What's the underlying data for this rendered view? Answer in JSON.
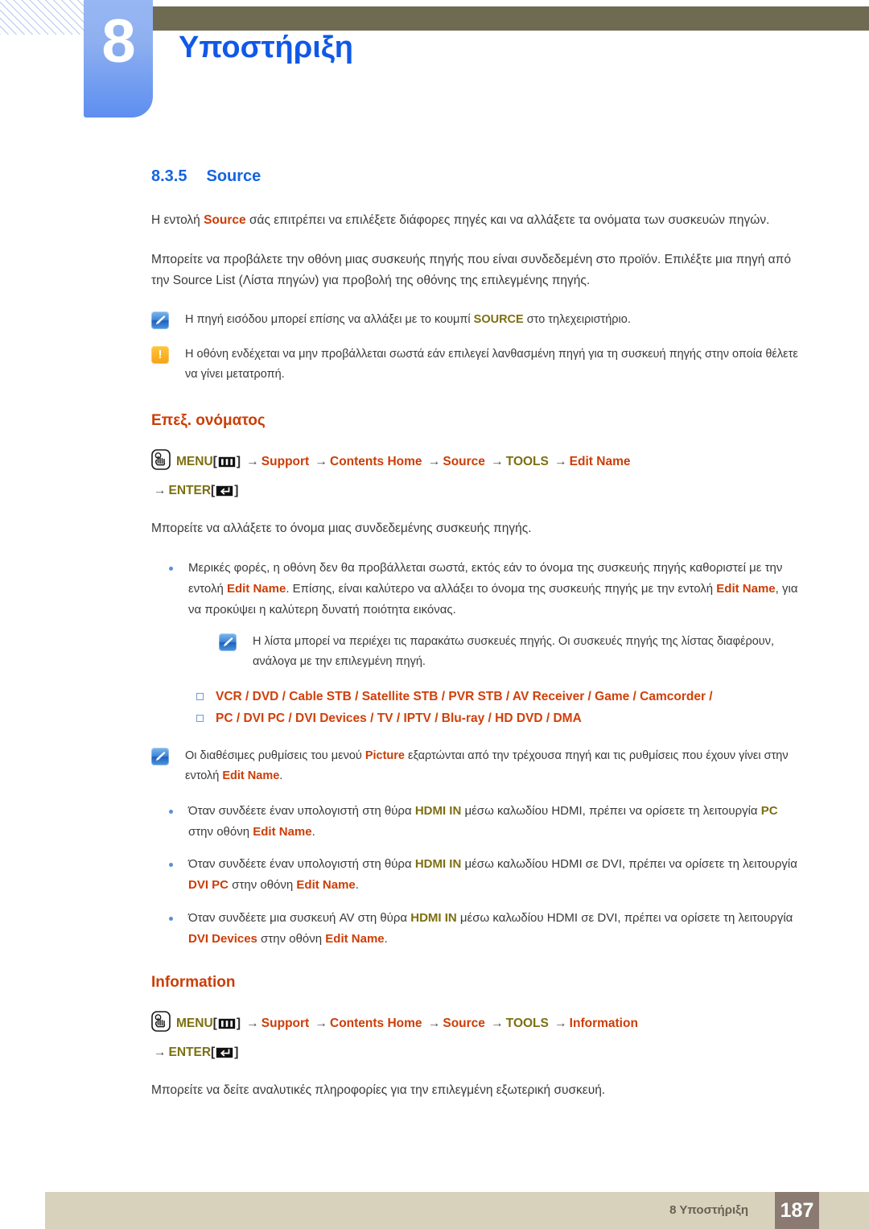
{
  "header": {
    "chapter_number": "8",
    "chapter_title": "Υποστήριξη",
    "accent_blue": "#1058e8",
    "olive_bar_color": "#6f6a52",
    "tab_color": "#6f9bf0"
  },
  "section": {
    "number": "8.3.5",
    "title": "Source",
    "heading_color": "#1565e0"
  },
  "intro": {
    "p1_before": "Η εντολή ",
    "p1_highlight": "Source",
    "p1_after": " σάς επιτρέπει να επιλέξετε διάφορες πηγές και να αλλάξετε τα ονόματα των συσκευών πηγών.",
    "p2": "Μπορείτε να προβάλετε την οθόνη μιας συσκευής πηγής που είναι συνδεδεμένη στο προϊόν. Επιλέξτε μια πηγή από την Source List (Λίστα πηγών) για προβολή της οθόνης της επιλεγμένης πηγής."
  },
  "notes": {
    "note1_before": "Η πηγή εισόδου μπορεί επίσης να αλλάξει με το κουμπί ",
    "note1_key": "SOURCE",
    "note1_after": " στο τηλεχειριστήριο.",
    "warn1": "Η οθόνη ενδέχεται να μην προβάλλεται σωστά εάν επιλεγεί λανθασμένη πηγή για τη συσκευή πηγής στην οποία θέλετε να γίνει μετατροπή.",
    "note2": "Η λίστα μπορεί να περιέχει τις παρακάτω συσκευές πηγής. Οι συσκευές πηγής της λίστας διαφέρουν, ανάλογα με την επιλεγμένη πηγή.",
    "note3_a": "Οι διαθέσιμες ρυθμίσεις του μενού ",
    "note3_picture": "Picture",
    "note3_b": " εξαρτώνται από την τρέχουσα πηγή και τις ρυθμίσεις που έχουν γίνει στην εντολή ",
    "note3_editname": "Edit Name",
    "note3_c": "."
  },
  "edit_name": {
    "sub_heading": "Επεξ. ονόματος",
    "menu_path": {
      "hand_icon": "hand-pointer-icon",
      "menu_label": "MENU",
      "menu_key_icon": "menu-bars-icon",
      "steps": [
        "Support",
        "Contents Home",
        "Source",
        "TOOLS",
        "Edit Name"
      ],
      "enter_label": "ENTER",
      "enter_key_icon": "enter-arrow-icon",
      "arrow": "→",
      "bracket_open": "[",
      "bracket_close": "]"
    },
    "body": "Μπορείτε να αλλάξετε το όνομα μιας συνδεδεμένης συσκευής πηγής.",
    "bullet1_a": "Μερικές φορές, η οθόνη δεν θα προβάλλεται σωστά, εκτός εάν το όνομα της συσκευής πηγής καθοριστεί με την εντολή ",
    "bullet1_edit1": "Edit Name",
    "bullet1_b": ". Επίσης, είναι καλύτερο να αλλάξει το όνομα της συσκευής πηγής με την εντολή ",
    "bullet1_edit2": "Edit Name",
    "bullet1_c": ", για να προκύψει η καλύτερη δυνατή ποιότητα εικόνας.",
    "devices_line1": "VCR / DVD / Cable STB / Satellite STB / PVR STB / AV Receiver / Game / Camcorder /",
    "devices_line2": "PC / DVI PC / DVI Devices / TV / IPTV / Blu-ray / HD DVD / DMA",
    "devices": [
      "VCR",
      "DVD",
      "Cable STB",
      "Satellite STB",
      "PVR STB",
      "AV Receiver",
      "Game",
      "Camcorder",
      "PC",
      "DVI PC",
      "DVI Devices",
      "TV",
      "IPTV",
      "Blu-ray",
      "HD DVD",
      "DMA"
    ],
    "bullet2_a": "Όταν συνδέετε έναν υπολογιστή στη θύρα ",
    "bullet2_hdmi": "HDMI IN",
    "bullet2_b": " μέσω καλωδίου HDMI, πρέπει να ορίσετε τη λειτουργία ",
    "bullet2_mode": "PC",
    "bullet2_c": " στην οθόνη ",
    "bullet2_edit": "Edit Name",
    "bullet2_d": ".",
    "bullet3_a": "Όταν συνδέετε έναν υπολογιστή στη θύρα ",
    "bullet3_hdmi": "HDMI IN",
    "bullet3_b": " μέσω καλωδίου HDMI σε DVI, πρέπει να ορίσετε τη λειτουργία ",
    "bullet3_mode": "DVI PC",
    "bullet3_c": " στην οθόνη ",
    "bullet3_edit": "Edit Name",
    "bullet3_d": ".",
    "bullet4_a": "Όταν συνδέετε μια συσκευή AV στη θύρα ",
    "bullet4_hdmi": "HDMI IN",
    "bullet4_b": " μέσω καλωδίου HDMI σε DVI, πρέπει να ορίσετε τη λειτουργία ",
    "bullet4_mode": "DVI Devices",
    "bullet4_c": " στην οθόνη ",
    "bullet4_edit": "Edit Name",
    "bullet4_d": "."
  },
  "information": {
    "sub_heading": "Information",
    "menu_path": {
      "menu_label": "MENU",
      "steps": [
        "Support",
        "Contents Home",
        "Source",
        "TOOLS",
        "Information"
      ],
      "enter_label": "ENTER"
    },
    "body": "Μπορείτε να δείτε αναλυτικές πληροφορίες για την επιλεγμένη εξωτερική συσκευή."
  },
  "footer": {
    "label": "8 Υποστήριξη",
    "page_number": "187",
    "bar_color": "#d8d2bd",
    "page_box_color": "#8a7a71"
  },
  "colors": {
    "orange": "#cc3d06",
    "gold": "#7d6f10",
    "blue": "#1565e0"
  }
}
